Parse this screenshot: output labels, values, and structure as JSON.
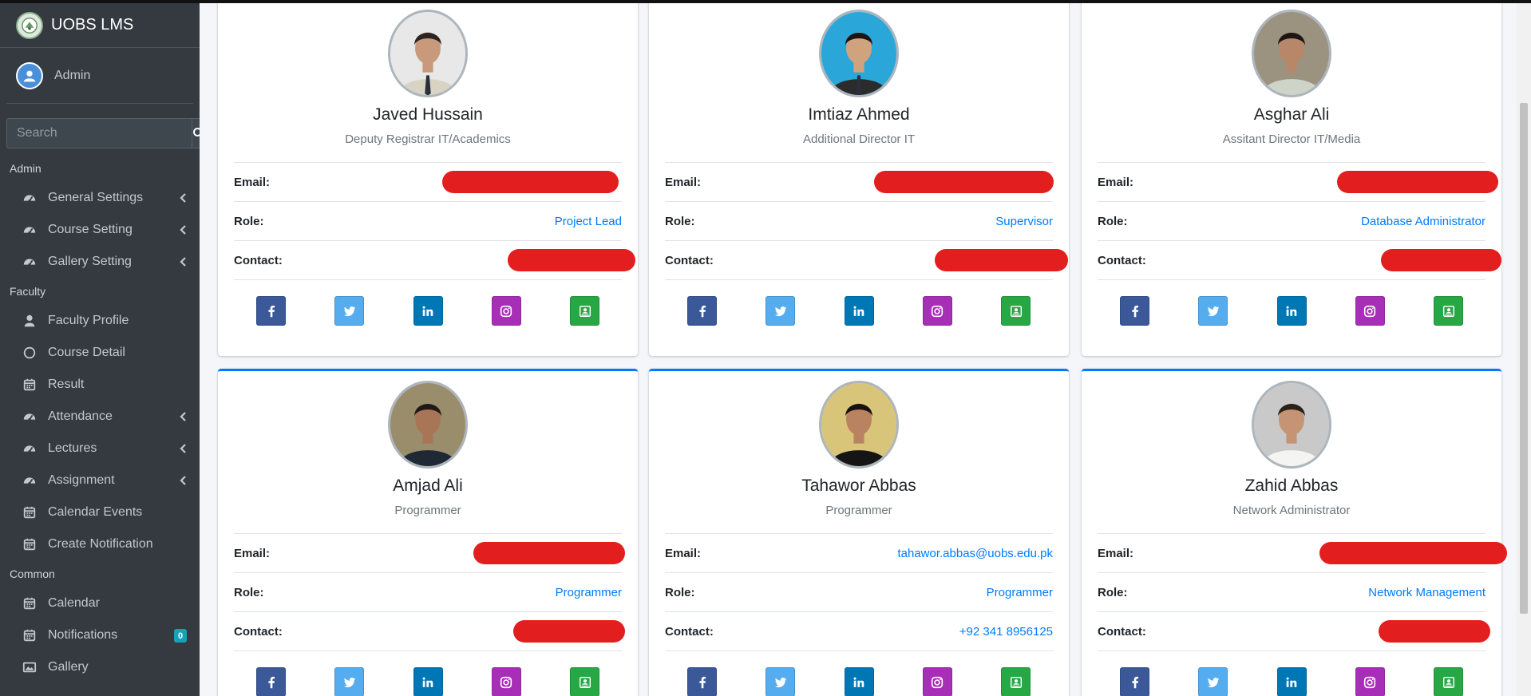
{
  "sidebar": {
    "brand": "UOBS LMS",
    "user": "Admin",
    "search_placeholder": "Search",
    "sections": [
      {
        "header": "Admin",
        "items": [
          {
            "label": "General Settings",
            "icon": "dashboard-gauge-icon",
            "chevron": true
          },
          {
            "label": "Course Setting",
            "icon": "dashboard-gauge-icon",
            "chevron": true
          },
          {
            "label": "Gallery Setting",
            "icon": "dashboard-gauge-icon",
            "chevron": true
          }
        ]
      },
      {
        "header": "Faculty",
        "items": [
          {
            "label": "Faculty Profile",
            "icon": "user-icon",
            "chevron": false
          },
          {
            "label": "Course Detail",
            "icon": "circle-icon",
            "chevron": false
          },
          {
            "label": "Result",
            "icon": "calendar-icon",
            "chevron": false
          },
          {
            "label": "Attendance",
            "icon": "dashboard-gauge-icon",
            "chevron": true
          },
          {
            "label": "Lectures",
            "icon": "dashboard-gauge-icon",
            "chevron": true
          },
          {
            "label": "Assignment",
            "icon": "dashboard-gauge-icon",
            "chevron": true
          },
          {
            "label": "Calendar Events",
            "icon": "calendar-icon",
            "chevron": false
          },
          {
            "label": "Create Notification",
            "icon": "calendar-icon",
            "chevron": false
          }
        ]
      },
      {
        "header": "Common",
        "items": [
          {
            "label": "Calendar",
            "icon": "calendar-icon",
            "chevron": false
          },
          {
            "label": "Notifications",
            "icon": "calendar-icon",
            "chevron": false,
            "badge": "0"
          },
          {
            "label": "Gallery",
            "icon": "image-icon",
            "chevron": false
          }
        ]
      }
    ]
  },
  "labels": {
    "email": "Email:",
    "role": "Role:",
    "contact": "Contact:"
  },
  "colors": {
    "link": "#007bff",
    "redaction": "#e31e1e",
    "sidebar": "#343a40",
    "badge": "#17a2b8"
  },
  "cards": [
    {
      "name": "Javed Hussain",
      "title": "Deputy Registrar IT/Academics",
      "email": "",
      "role": "Project Lead",
      "contact": "",
      "email_redacted": true,
      "contact_redacted": true
    },
    {
      "name": "Imtiaz Ahmed",
      "title": "Additional Director IT",
      "email": "",
      "role": "Supervisor",
      "contact": "",
      "email_redacted": true,
      "contact_redacted": true
    },
    {
      "name": "Asghar Ali",
      "title": "Assitant Director IT/Media",
      "email": "",
      "role": "Database Administrator",
      "contact": "",
      "email_redacted": true,
      "contact_redacted": true
    },
    {
      "name": "Amjad Ali",
      "title": "Programmer",
      "email": "",
      "role": "Programmer",
      "contact": "",
      "email_redacted": true,
      "contact_redacted": true
    },
    {
      "name": "Tahawor Abbas",
      "title": "Programmer",
      "email": "tahawor.abbas@uobs.edu.pk",
      "role": "Programmer",
      "contact": "+92 341 8956125",
      "email_redacted": false,
      "contact_redacted": false
    },
    {
      "name": "Zahid Abbas",
      "title": "Network Administrator",
      "email": "",
      "role": "Network Management",
      "contact": "",
      "email_redacted": true,
      "contact_redacted": true
    }
  ],
  "social_icons": [
    "facebook-icon",
    "twitter-icon",
    "linkedin-icon",
    "instagram-icon",
    "google-classroom-icon"
  ]
}
